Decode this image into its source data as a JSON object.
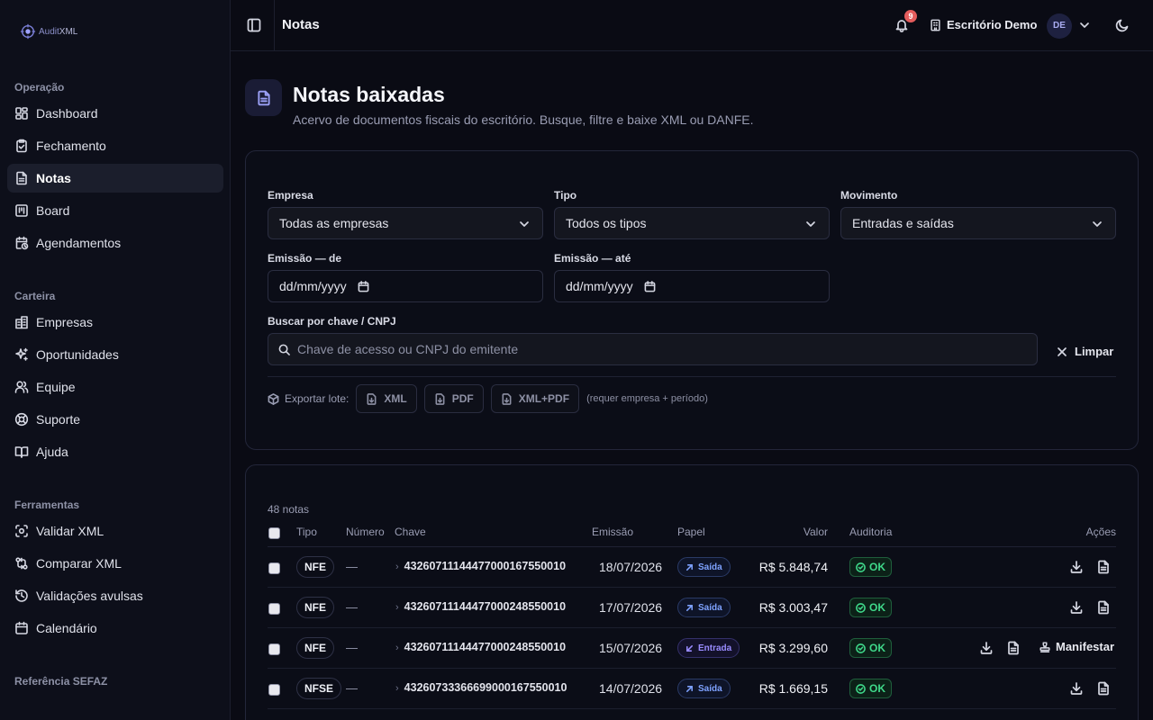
{
  "brand": {
    "name_a": "Audit",
    "name_b": "XML"
  },
  "sidebar": {
    "sections": [
      {
        "heading": "Operação",
        "items": [
          {
            "label": "Dashboard",
            "icon": "layout-grid-icon"
          },
          {
            "label": "Fechamento",
            "icon": "clipboard-check-icon"
          },
          {
            "label": "Notas",
            "icon": "file-text-icon",
            "active": true
          },
          {
            "label": "Board",
            "icon": "kanban-icon"
          },
          {
            "label": "Agendamentos",
            "icon": "calendar-clock-icon"
          }
        ]
      },
      {
        "heading": "Carteira",
        "items": [
          {
            "label": "Empresas",
            "icon": "building-icon"
          },
          {
            "label": "Oportunidades",
            "icon": "sparkles-icon"
          },
          {
            "label": "Equipe",
            "icon": "users-icon"
          },
          {
            "label": "Suporte",
            "icon": "life-buoy-icon"
          },
          {
            "label": "Ajuda",
            "icon": "book-open-icon"
          }
        ]
      },
      {
        "heading": "Ferramentas",
        "items": [
          {
            "label": "Validar XML",
            "icon": "scan-icon"
          },
          {
            "label": "Comparar XML",
            "icon": "git-compare-icon"
          },
          {
            "label": "Validações avulsas",
            "icon": "history-icon"
          },
          {
            "label": "Calendário",
            "icon": "calendar-icon"
          }
        ]
      },
      {
        "heading": "Referência SEFAZ",
        "items": []
      }
    ]
  },
  "header": {
    "title": "Notas",
    "notifications_count": "9",
    "office_name": "Escritório Demo",
    "avatar_initials": "DE"
  },
  "page": {
    "title": "Notas baixadas",
    "subtitle": "Acervo de documentos fiscais do escritório. Busque, filtre e baixe XML ou DANFE."
  },
  "filters": {
    "empresa_label": "Empresa",
    "empresa_value": "Todas as empresas",
    "tipo_label": "Tipo",
    "tipo_value": "Todos os tipos",
    "movimento_label": "Movimento",
    "movimento_value": "Entradas e saídas",
    "emissao_de_label": "Emissão — de",
    "emissao_de_value": "dd/mm/yyyy",
    "emissao_ate_label": "Emissão — até",
    "emissao_ate_value": "dd/mm/yyyy",
    "search_label": "Buscar por chave / CNPJ",
    "search_placeholder": "Chave de acesso ou CNPJ do emitente",
    "clear_label": "Limpar",
    "export_label": "Exportar lote:",
    "export_xml": "XML",
    "export_pdf": "PDF",
    "export_both": "XML+PDF",
    "export_note": "(requer empresa + período)"
  },
  "table": {
    "count": "48 notas",
    "columns": {
      "tipo": "Tipo",
      "numero": "Número",
      "chave": "Chave",
      "emissao": "Emissão",
      "papel": "Papel",
      "valor": "Valor",
      "auditoria": "Auditoria",
      "acoes": "Ações"
    },
    "manifest_label": "Manifestar",
    "rows": [
      {
        "tipo": "NFE",
        "numero": "—",
        "chave": "43260711144477000167550010",
        "emissao": "18/07/2026",
        "papel": "Saída",
        "papel_kind": "saida",
        "valor": "R$ 5.848,74",
        "auditoria": "OK",
        "manifest": false
      },
      {
        "tipo": "NFE",
        "numero": "—",
        "chave": "43260711144477000248550010",
        "emissao": "17/07/2026",
        "papel": "Saída",
        "papel_kind": "saida",
        "valor": "R$ 3.003,47",
        "auditoria": "OK",
        "manifest": false
      },
      {
        "tipo": "NFE",
        "numero": "—",
        "chave": "43260711144477000248550010",
        "emissao": "15/07/2026",
        "papel": "Entrada",
        "papel_kind": "entrada",
        "valor": "R$ 3.299,60",
        "auditoria": "OK",
        "manifest": true
      },
      {
        "tipo": "NFSE",
        "numero": "—",
        "chave": "43260733366699000167550010",
        "emissao": "14/07/2026",
        "papel": "Saída",
        "papel_kind": "saida",
        "valor": "R$ 1.669,15",
        "auditoria": "OK",
        "manifest": false
      }
    ]
  }
}
